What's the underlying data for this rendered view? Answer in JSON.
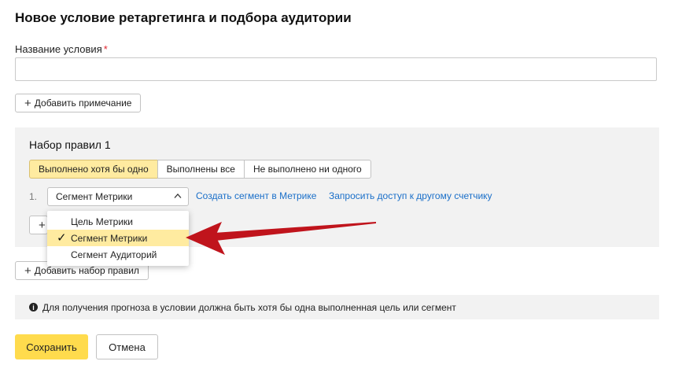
{
  "page": {
    "title": "Новое условие ретаргетинга и подбора аудитории"
  },
  "name_field": {
    "label": "Название условия",
    "required_mark": "*",
    "value": ""
  },
  "add_note_button": {
    "icon": "plus-icon",
    "label": "Добавить примечание"
  },
  "ruleset": {
    "title": "Набор правил 1",
    "modes": [
      {
        "label": "Выполнено хотя бы одно",
        "active": true
      },
      {
        "label": "Выполнены все",
        "active": false
      },
      {
        "label": "Не выполнено ни одного",
        "active": false
      }
    ],
    "rule": {
      "number": "1.",
      "select_value": "Сегмент Метрики",
      "links": [
        "Создать сегмент в Метрике",
        "Запросить доступ к другому счетчику"
      ]
    },
    "dropdown": {
      "options": [
        {
          "label": "Цель Метрики",
          "selected": false
        },
        {
          "label": "Сегмент Метрики",
          "selected": true
        },
        {
          "label": "Сегмент Аудиторий",
          "selected": false
        }
      ],
      "check_mark": "✓"
    }
  },
  "add_ruleset_button": {
    "icon": "plus-icon",
    "label": "Добавить набор правил"
  },
  "info": {
    "icon": "info-icon",
    "text": "Для получения прогноза в условии должна быть хотя бы одна выполненная цель или сегмент"
  },
  "actions": {
    "save_label": "Сохранить",
    "cancel_label": "Отмена"
  },
  "colors": {
    "accent_yellow": "#ffdb4d",
    "active_tab": "#ffeba0",
    "link": "#1a6fc9",
    "annotation_arrow": "#c0141c"
  }
}
